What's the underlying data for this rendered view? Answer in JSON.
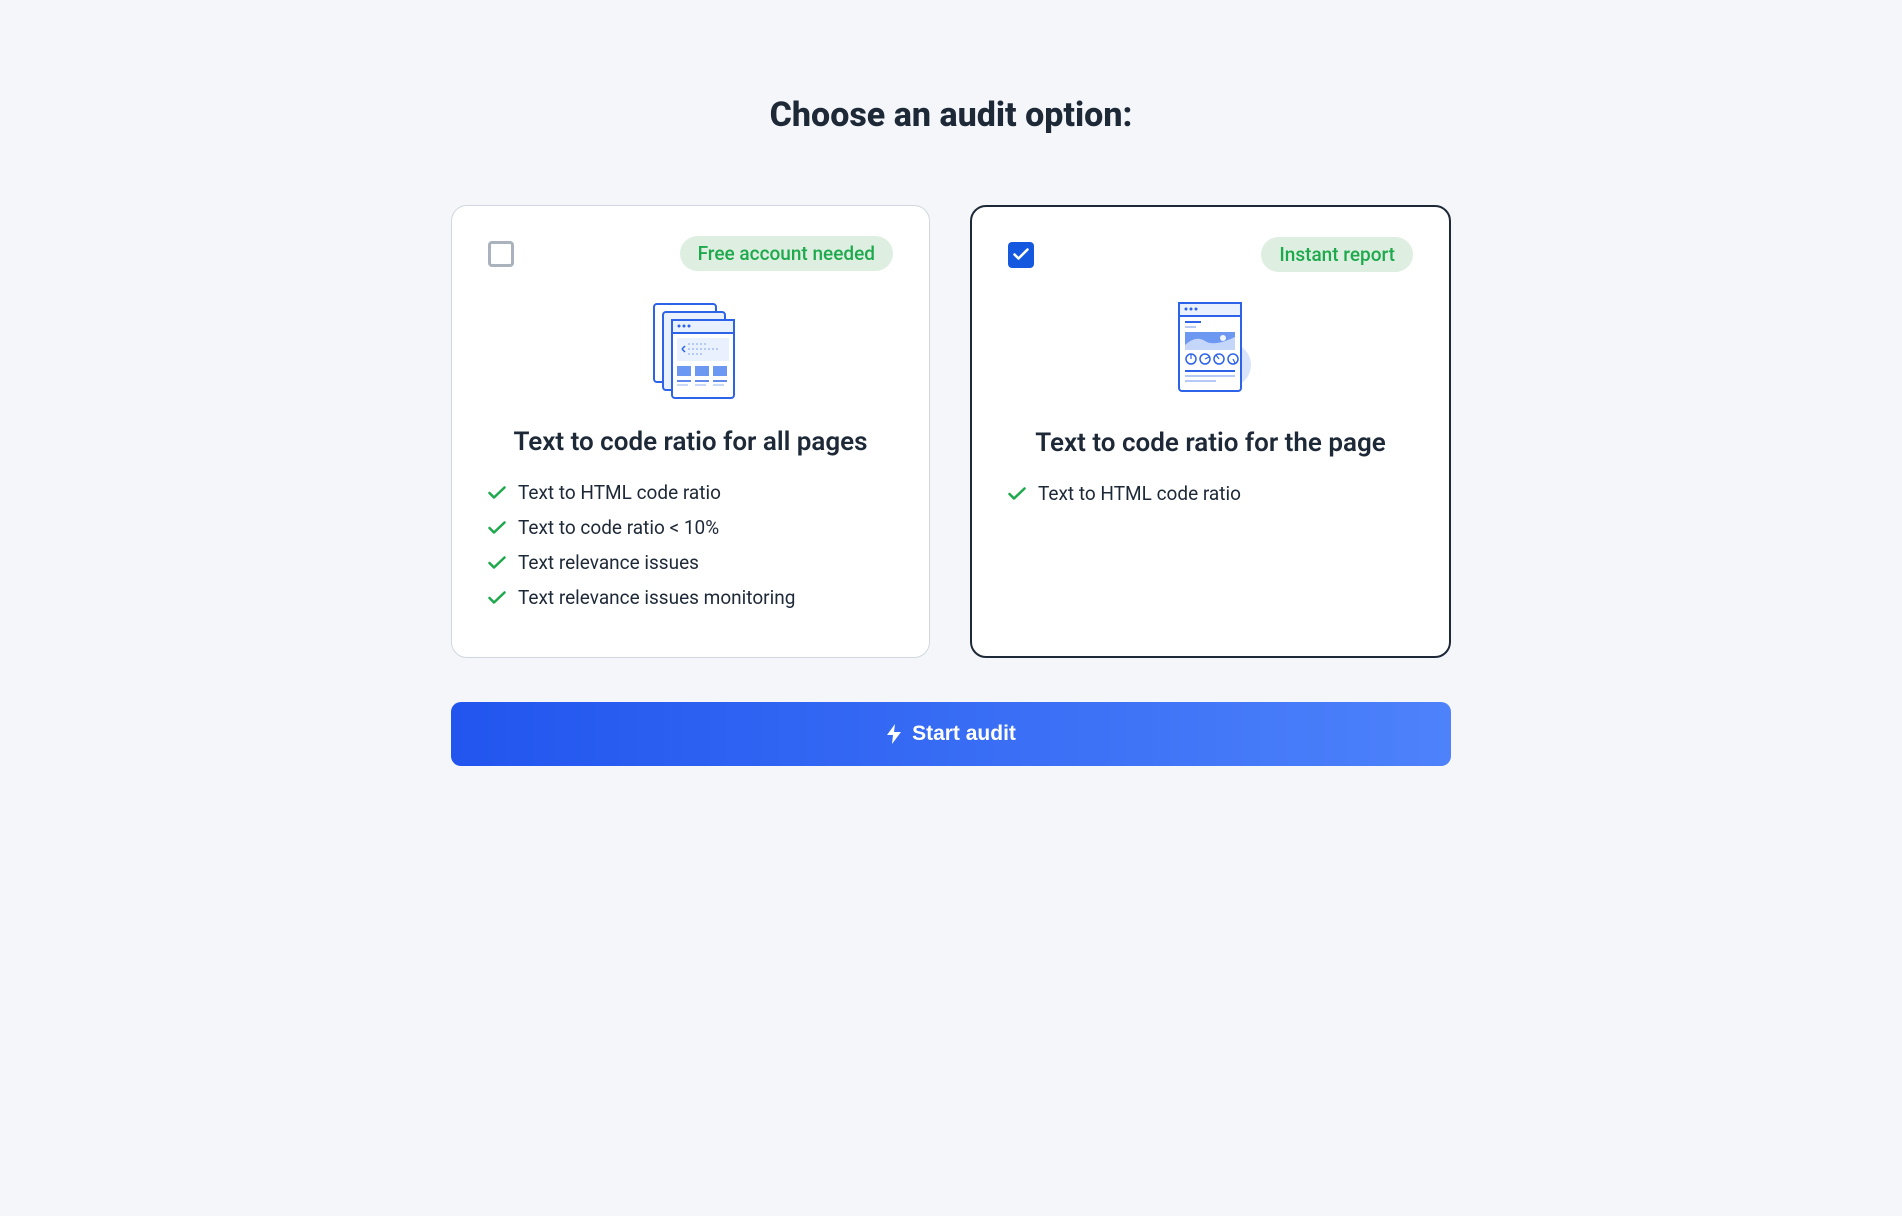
{
  "title": "Choose an audit option:",
  "cards": [
    {
      "selected": false,
      "badge": "Free account needed",
      "title": "Text to code ratio for all pages",
      "features": [
        "Text to HTML code ratio",
        "Text to code ratio < 10%",
        "Text relevance issues",
        "Text relevance issues monitoring"
      ]
    },
    {
      "selected": true,
      "badge": "Instant report",
      "title": "Text to code ratio for the page",
      "features": [
        "Text to HTML code ratio"
      ]
    }
  ],
  "button": {
    "label": "Start audit"
  }
}
